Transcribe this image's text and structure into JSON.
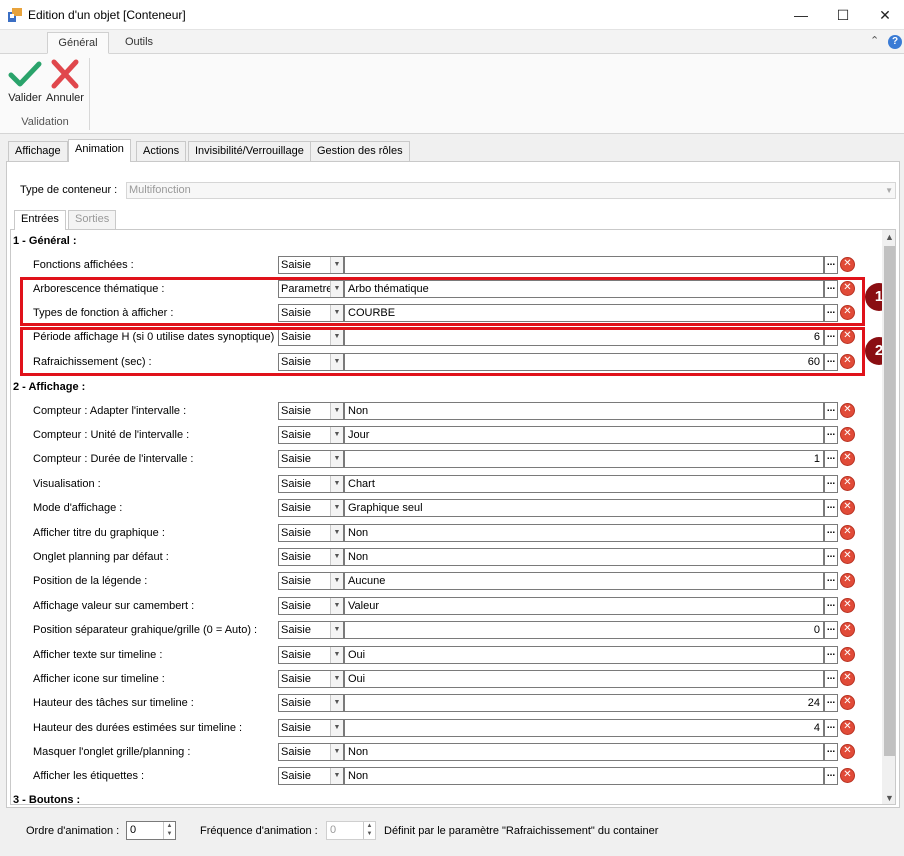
{
  "window": {
    "title": "Edition d'un objet [Conteneur]"
  },
  "ribbon": {
    "tabs": [
      "Général",
      "Outils"
    ],
    "buttons": {
      "validate": "Valider",
      "cancel": "Annuler"
    },
    "group": "Validation"
  },
  "main_tabs": [
    "Affichage",
    "Animation",
    "Actions",
    "Invisibilité/Verrouillage",
    "Gestion des rôles"
  ],
  "container_type": {
    "label": "Type de conteneur :",
    "value": "Multifonction"
  },
  "sub_tabs": [
    "Entrées",
    "Sorties"
  ],
  "sections": {
    "general": "1 - Général :",
    "display": "2 - Affichage :",
    "buttons": "3 - Boutons :"
  },
  "rows": [
    {
      "label": "Fonctions affichées :",
      "mode": "Saisie",
      "value": ""
    },
    {
      "label": "Arborescence thématique :",
      "mode": "Parametre",
      "value": "Arbo thématique"
    },
    {
      "label": "Types de fonction à afficher :",
      "mode": "Saisie",
      "value": "COURBE"
    },
    {
      "label": "Période affichage H (si 0 utilise dates synoptique) :",
      "mode": "Saisie",
      "value": "6"
    },
    {
      "label": "Rafraichissement (sec) :",
      "mode": "Saisie",
      "value": "60"
    },
    {
      "label": "Compteur : Adapter l'intervalle :",
      "mode": "Saisie",
      "value": "Non"
    },
    {
      "label": "Compteur : Unité de l'intervalle :",
      "mode": "Saisie",
      "value": "Jour"
    },
    {
      "label": "Compteur : Durée de l'intervalle :",
      "mode": "Saisie",
      "value": "1"
    },
    {
      "label": "Visualisation :",
      "mode": "Saisie",
      "value": "Chart"
    },
    {
      "label": "Mode d'affichage :",
      "mode": "Saisie",
      "value": "Graphique seul"
    },
    {
      "label": "Afficher titre du graphique :",
      "mode": "Saisie",
      "value": "Non"
    },
    {
      "label": "Onglet planning par défaut :",
      "mode": "Saisie",
      "value": "Non"
    },
    {
      "label": "Position de la légende :",
      "mode": "Saisie",
      "value": "Aucune"
    },
    {
      "label": "Affichage valeur sur camembert :",
      "mode": "Saisie",
      "value": "Valeur"
    },
    {
      "label": "Position séparateur grahique/grille (0 = Auto) :",
      "mode": "Saisie",
      "value": "0"
    },
    {
      "label": "Afficher texte sur timeline :",
      "mode": "Saisie",
      "value": "Oui"
    },
    {
      "label": "Afficher icone sur timeline :",
      "mode": "Saisie",
      "value": "Oui"
    },
    {
      "label": "Hauteur des tâches sur timeline :",
      "mode": "Saisie",
      "value": "24"
    },
    {
      "label": "Hauteur des durées estimées sur timeline :",
      "mode": "Saisie",
      "value": "4"
    },
    {
      "label": "Masquer l'onglet grille/planning :",
      "mode": "Saisie",
      "value": "Non"
    },
    {
      "label": "Afficher les étiquettes :",
      "mode": "Saisie",
      "value": "Non"
    }
  ],
  "badges": [
    "1",
    "2"
  ],
  "bottom": {
    "order_label": "Ordre d'animation :",
    "order_value": "0",
    "freq_label": "Fréquence d'animation :",
    "freq_value": "0",
    "freq_note": "Définit par le paramètre \"Rafraichissement\" du container"
  }
}
